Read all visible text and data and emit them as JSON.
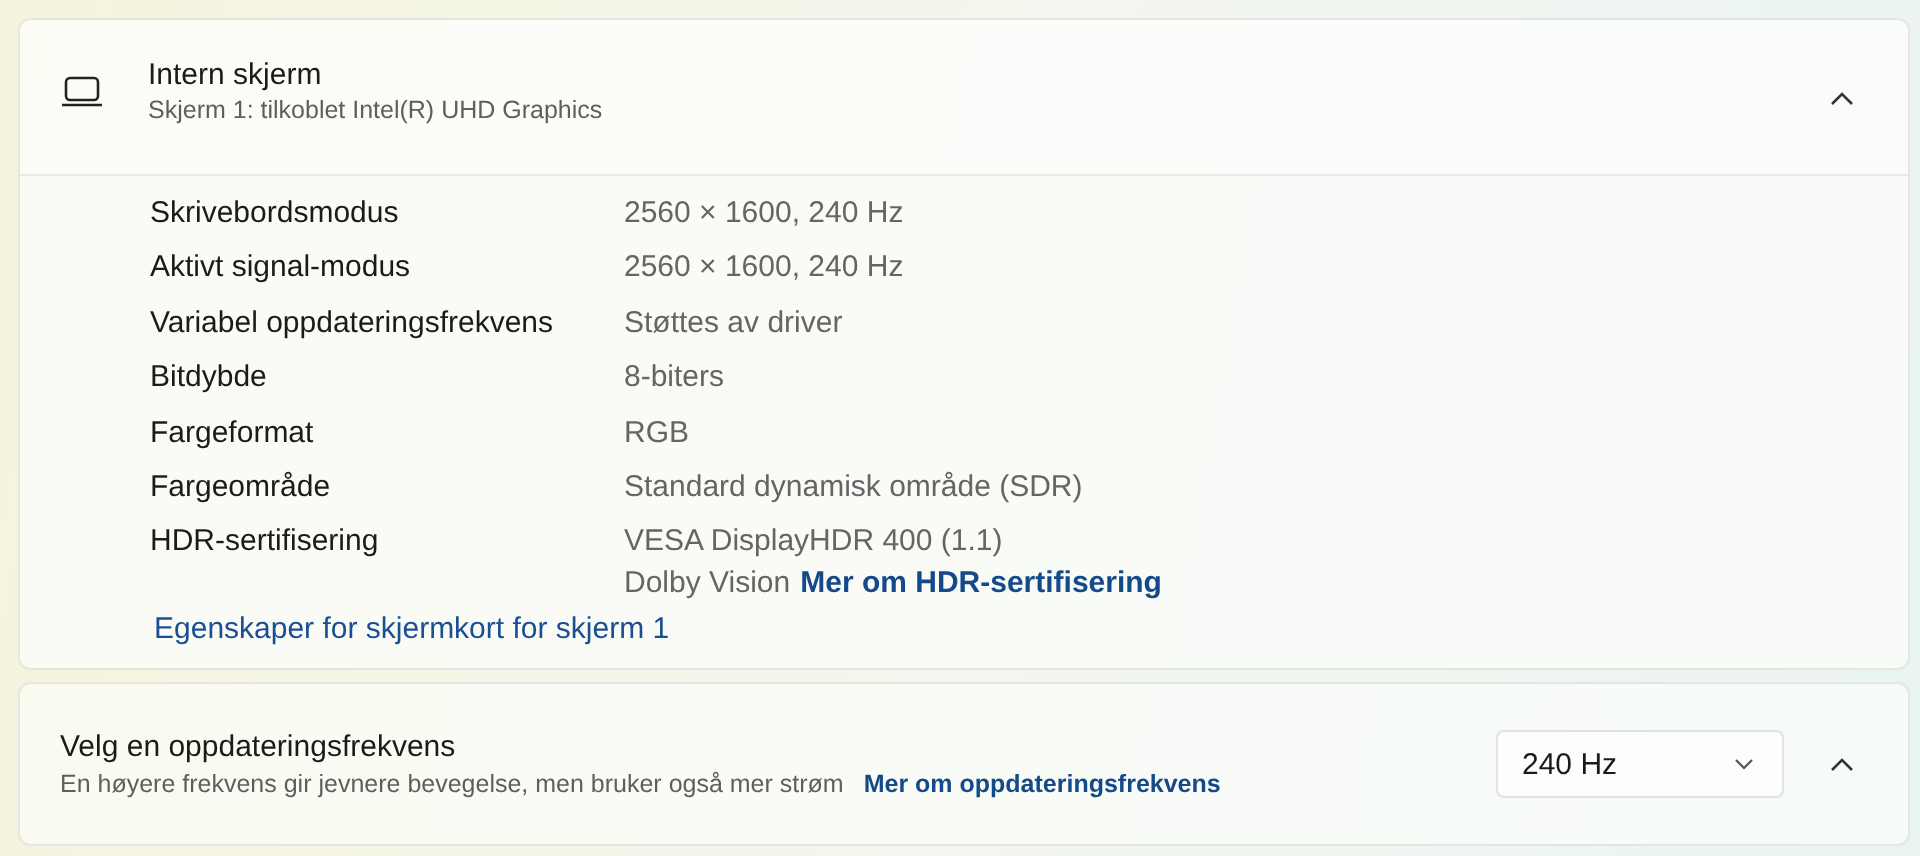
{
  "display_card": {
    "title": "Intern skjerm",
    "subtitle": "Skjerm 1: tilkoblet Intel(R) UHD Graphics",
    "expanded": true,
    "rows": [
      {
        "label": "Skrivebordsmodus",
        "value": "2560 × 1600, 240 Hz"
      },
      {
        "label": "Aktivt signal-modus",
        "value": "2560 × 1600, 240 Hz"
      },
      {
        "label": "Variabel oppdateringsfrekvens",
        "value": "Støttes av driver"
      },
      {
        "label": "Bitdybde",
        "value": "8-biters"
      },
      {
        "label": "Fargeformat",
        "value": "RGB"
      },
      {
        "label": "Fargeområde",
        "value": "Standard dynamisk område (SDR)"
      },
      {
        "label": "HDR-sertifisering",
        "value": "VESA DisplayHDR 400 (1.1)",
        "extra": "Dolby Vision",
        "link": "Mer om HDR-sertifisering"
      }
    ],
    "adapter_link": "Egenskaper for skjermkort for skjerm 1"
  },
  "refresh_card": {
    "title": "Velg en oppdateringsfrekvens",
    "description": "En høyere frekvens gir jevnere bevegelse, men bruker også mer strøm",
    "link": "Mer om oppdateringsfrekvens",
    "dropdown_value": "240 Hz",
    "expanded": true
  }
}
